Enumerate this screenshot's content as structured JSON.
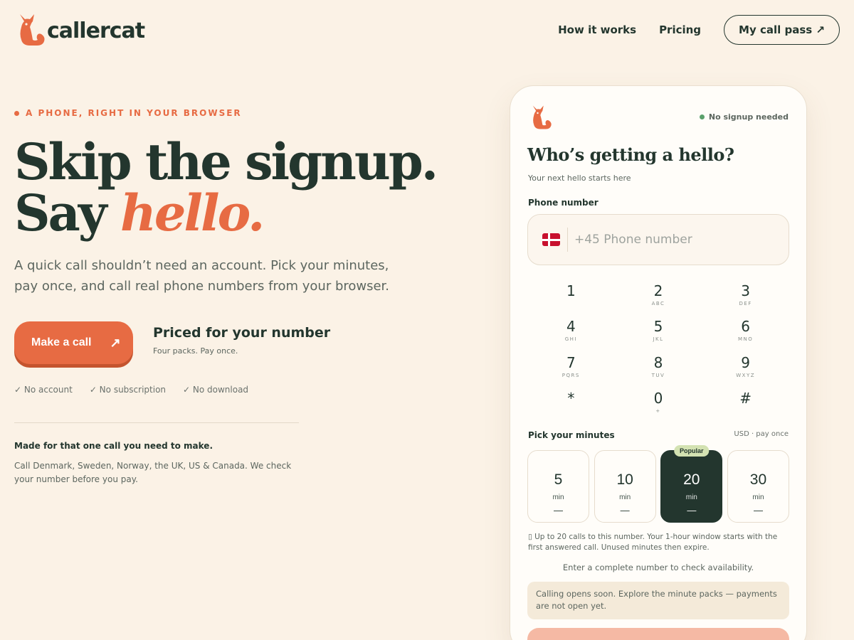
{
  "brand": {
    "name": "callercat",
    "color": "#e76b43",
    "ink": "#23362e"
  },
  "nav": {
    "how_it_works": "How it works",
    "pricing": "Pricing",
    "my_call_pass": "My call pass ↗"
  },
  "hero": {
    "eyebrow": "A PHONE, RIGHT IN YOUR BROWSER",
    "headline_line1": "Skip the signup.",
    "headline_say": "Say ",
    "headline_accent": "hello.",
    "lead": "A quick call shouldn’t need an account. Pick your minutes, pay once, and call real phone numbers from your browser.",
    "cta_label": "Make a call",
    "cta_arrow": "↗",
    "priced_title": "Priced for your number",
    "priced_sub": "Four packs. Pay once.",
    "checks": [
      "✓ No account",
      "✓ No subscription",
      "✓ No download"
    ],
    "made_title": "Made for that one call you need to make.",
    "made_body": "Call Denmark, Sweden, Norway, the UK, US & Canada. We check your number before you pay."
  },
  "card": {
    "badge": "No signup needed",
    "title": "Who’s getting a hello?",
    "subtitle": "Your next hello starts here",
    "phone_label": "Phone number",
    "phone_placeholder": "+45 Phone number",
    "phone_value": "",
    "flag": "denmark-flag",
    "keypad": [
      {
        "digit": "1",
        "letters": ""
      },
      {
        "digit": "2",
        "letters": "ABC"
      },
      {
        "digit": "3",
        "letters": "DEF"
      },
      {
        "digit": "4",
        "letters": "GHI"
      },
      {
        "digit": "5",
        "letters": "JKL"
      },
      {
        "digit": "6",
        "letters": "MNO"
      },
      {
        "digit": "7",
        "letters": "PQRS"
      },
      {
        "digit": "8",
        "letters": "TUV"
      },
      {
        "digit": "9",
        "letters": "WXYZ"
      },
      {
        "digit": "*",
        "letters": ""
      },
      {
        "digit": "0",
        "letters": "+"
      },
      {
        "digit": "#",
        "letters": ""
      }
    ],
    "minutes_label": "Pick your minutes",
    "currency_note": "USD · pay once",
    "packs": [
      {
        "minutes": "5",
        "unit": "min",
        "price": "—",
        "selected": false
      },
      {
        "minutes": "10",
        "unit": "min",
        "price": "—",
        "selected": false
      },
      {
        "minutes": "20",
        "unit": "min",
        "price": "—",
        "selected": true,
        "tag": "Popular"
      },
      {
        "minutes": "30",
        "unit": "min",
        "price": "—",
        "selected": false
      }
    ],
    "pack_note": "▯ Up to 20 calls to this number. Your 1-hour window starts with the first answered call. Unused minutes then expire.",
    "availability": "Enter a complete number to check availability.",
    "calling_soon": "Calling opens soon. Explore the minute packs — payments are not open yet."
  }
}
